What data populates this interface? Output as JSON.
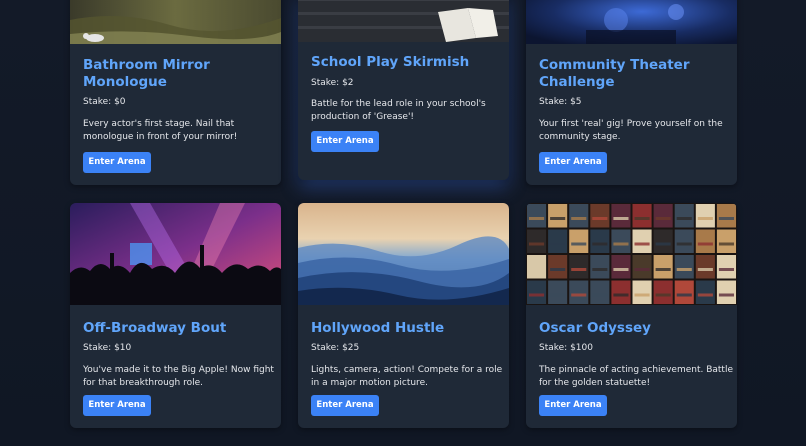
{
  "cards": [
    {
      "title_line1": "Bathroom Mirror",
      "title_line2": "Monologue",
      "stake": "Stake: $0",
      "desc_line1": "Every actor's first stage. Nail that",
      "desc_line2": "monologue in front of your mirror!",
      "button": "Enter Arena"
    },
    {
      "title_line1": "School Play Skirmish",
      "stake": "Stake: $2",
      "desc_line1": "Battle for the lead role in your school's",
      "desc_line2": "production of 'Grease'!",
      "button": "Enter Arena"
    },
    {
      "title_line1": "Community Theater",
      "title_line2": "Challenge",
      "stake": "Stake: $5",
      "desc_line1": "Your first 'real' gig! Prove yourself on the",
      "desc_line2": "community stage.",
      "button": "Enter Arena"
    },
    {
      "title_line1": "Off-Broadway Bout",
      "stake": "Stake: $10",
      "desc_line1": "You've made it to the Big Apple! Now fight",
      "desc_line2": "for that breakthrough role.",
      "button": "Enter Arena"
    },
    {
      "title_line1": "Hollywood Hustle",
      "stake": "Stake: $25",
      "desc_line1": "Lights, camera, action! Compete for a role",
      "desc_line2": "in a major motion picture.",
      "button": "Enter Arena"
    },
    {
      "title_line1": "Oscar Odyssey",
      "stake": "Stake: $100",
      "desc_line1": "The pinnacle of acting achievement. Battle",
      "desc_line2": "for the golden statuette!",
      "button": "Enter Arena"
    }
  ],
  "colors": {
    "background": "#111827",
    "card": "#1f2937",
    "title": "#60a5fa",
    "button": "#3b82f6"
  }
}
